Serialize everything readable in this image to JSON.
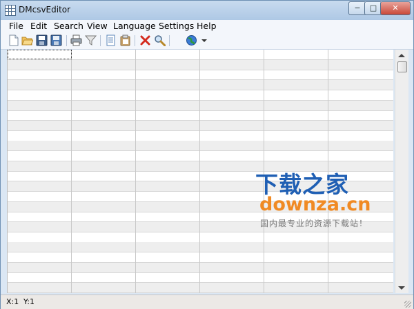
{
  "window": {
    "title": "DMcsvEditor",
    "min_symbol": "−",
    "max_symbol": "□",
    "close_symbol": "✕"
  },
  "menu": [
    "File",
    "Edit",
    "Search",
    "View",
    "Language",
    "Settings",
    "Help"
  ],
  "toolbar": {
    "icons": [
      "new-file-icon",
      "open-folder-icon",
      "save-icon",
      "save-as-icon",
      "print-icon",
      "filter-icon",
      "copy-icon",
      "paste-icon",
      "delete-icon",
      "search-icon",
      "globe-icon",
      "dropdown-arrow-icon"
    ]
  },
  "grid": {
    "columns": 6,
    "visible_rows": 24,
    "selected_cell": "row 1, column 1"
  },
  "status": {
    "x": "X:1",
    "y": "Y:1"
  },
  "watermark": {
    "line1": "下载之家",
    "line2": "downza.cn",
    "line3": "国内最专业的资源下载站！"
  },
  "colors": {
    "title_bar": "#aec8e5",
    "alt_row": "#eeeeee",
    "delete": "#d42b1e",
    "watermark_blue": "#1f5fb4",
    "watermark_orange": "#f08a23"
  }
}
